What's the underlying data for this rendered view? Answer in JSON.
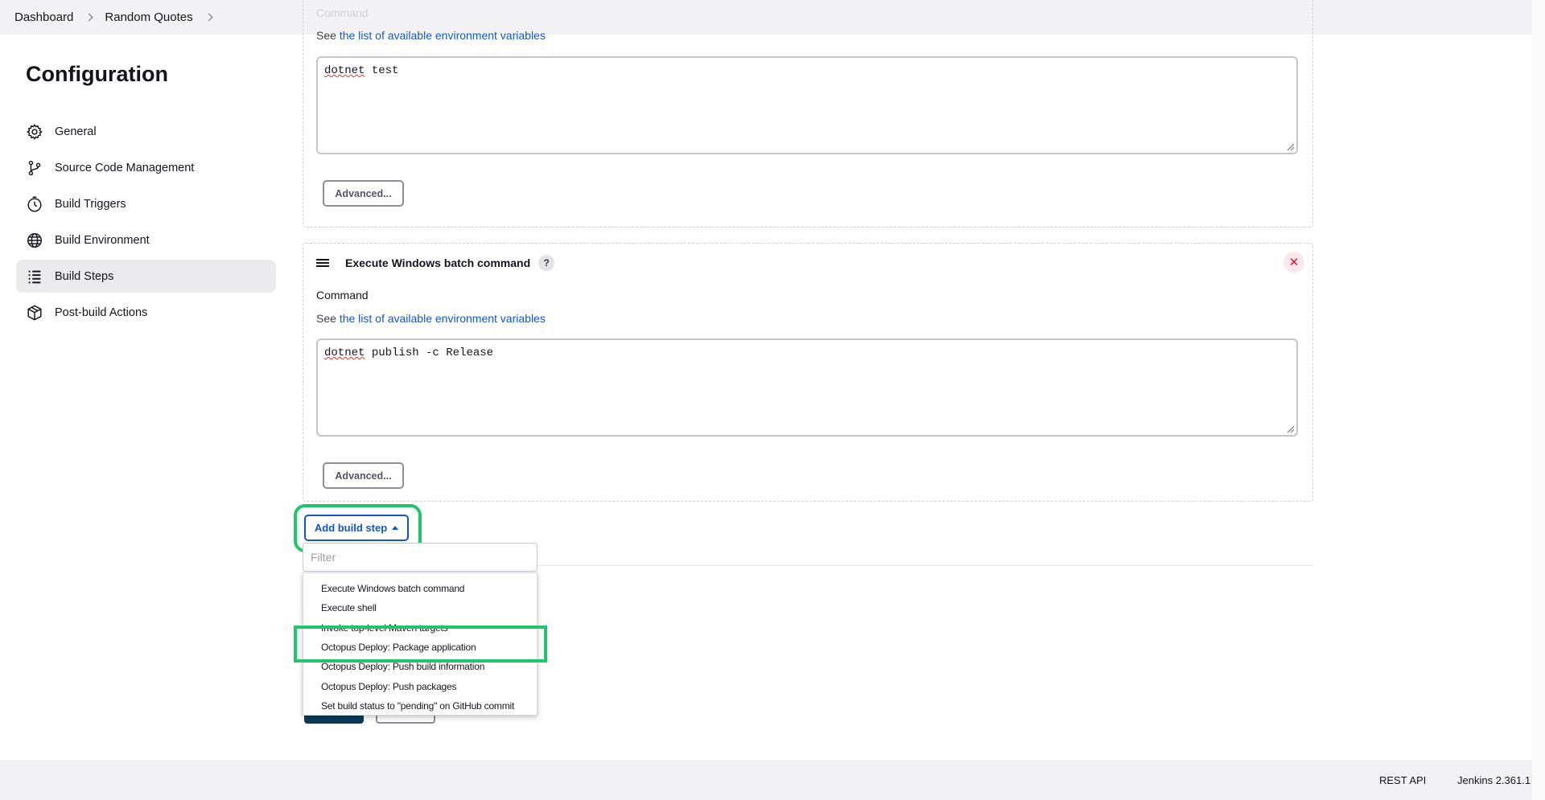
{
  "breadcrumb": {
    "items": [
      "Dashboard",
      "Random Quotes"
    ]
  },
  "sidebar": {
    "title": "Configuration",
    "items": [
      {
        "label": "General",
        "icon": "gear-icon"
      },
      {
        "label": "Source Code Management",
        "icon": "branch-icon"
      },
      {
        "label": "Build Triggers",
        "icon": "timer-icon"
      },
      {
        "label": "Build Environment",
        "icon": "globe-icon"
      },
      {
        "label": "Build Steps",
        "icon": "list-icon",
        "active": true
      },
      {
        "label": "Post-build Actions",
        "icon": "package-icon"
      }
    ]
  },
  "steps": [
    {
      "ghost_label": "Command",
      "see_prefix": "See ",
      "env_link": "the list of available environment variables",
      "command_word": "dotnet",
      "command_rest": " test",
      "advanced_label": "Advanced..."
    },
    {
      "title": "Execute Windows batch command",
      "help": "?",
      "close": "✕",
      "command_label": "Command",
      "see_prefix": "See ",
      "env_link": "the list of available environment variables",
      "command_word": "dotnet",
      "command_rest": " publish -c Release",
      "advanced_label": "Advanced..."
    }
  ],
  "add_step": {
    "label": "Add build step",
    "filter_placeholder": "Filter",
    "options": [
      "Execute Windows batch command",
      "Execute shell",
      "Invoke top-level Maven targets",
      "Octopus Deploy: Package application",
      "Octopus Deploy: Push build information",
      "Octopus Deploy: Push packages",
      "Set build status to \"pending\" on GitHub commit"
    ],
    "highlighted": "Octopus Deploy: Package application"
  },
  "footer": {
    "rest_api": "REST API",
    "version": "Jenkins 2.361.1"
  },
  "colors": {
    "accent": "#1056c7",
    "highlight": "#1ec66a",
    "danger": "#d3142d"
  }
}
